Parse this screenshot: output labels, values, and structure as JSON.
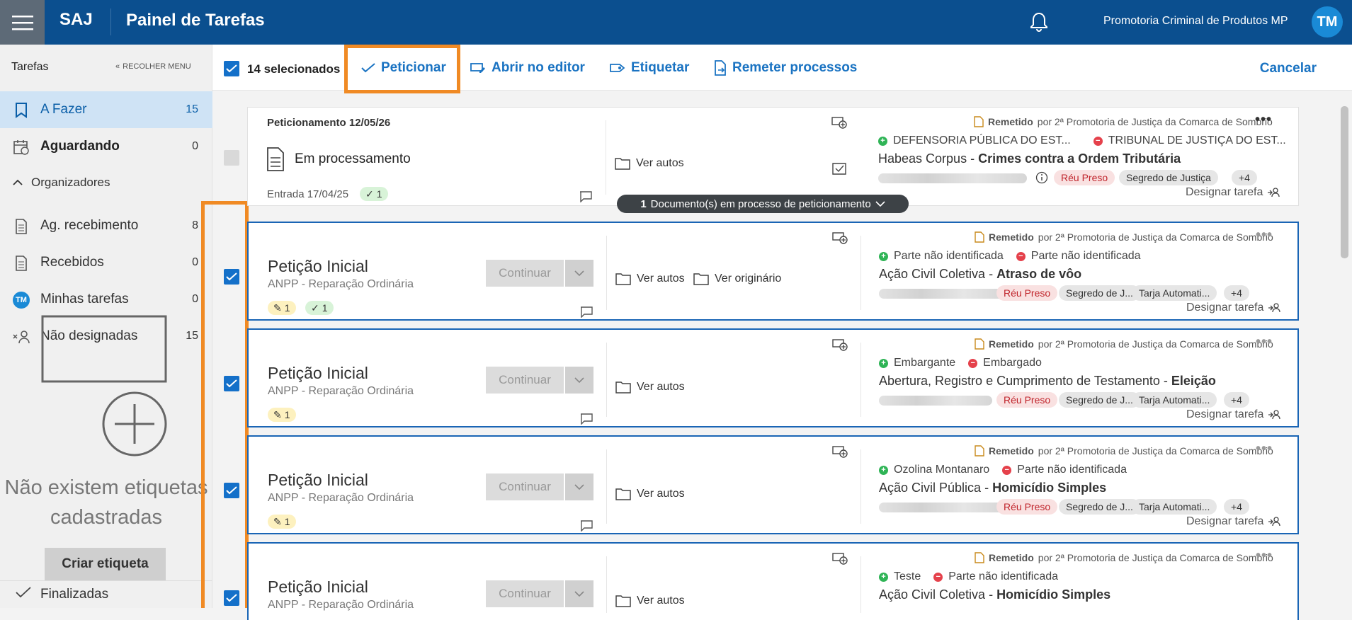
{
  "topbar": {
    "brand": "SAJ",
    "title": "Painel de Tarefas",
    "org": "Promotoria Criminal de Produtos MP",
    "avatar": "TM",
    "color": "#0b4f8f"
  },
  "sidebar": {
    "title": "Tarefas",
    "collapse": "RECOLHER MENU",
    "items": [
      {
        "label": "A Fazer",
        "count": "15",
        "icon": "bookmark-icon"
      },
      {
        "label": "Aguardando",
        "count": "0",
        "icon": "calendar-icon"
      },
      {
        "label": "Ag. recebimento",
        "count": "8",
        "icon": "document-icon"
      },
      {
        "label": "Recebidos",
        "count": "0",
        "icon": "document-icon"
      },
      {
        "label": "Minhas tarefas",
        "count": "0",
        "icon": "avatar-icon",
        "avatar": "TM"
      },
      {
        "label": "Não designadas",
        "count": "15",
        "icon": "unassigned-user-icon"
      }
    ],
    "organizers": "Organizadores",
    "empty_line1": "Não existem etiquetas",
    "empty_line2": "cadastradas",
    "create_label": "Criar etiqueta",
    "finalizadas": "Finalizadas"
  },
  "toolbar": {
    "selected": "14 selecionados",
    "peticionar": "Peticionar",
    "abrir_editor": "Abrir no editor",
    "etiquetar": "Etiquetar",
    "remeter": "Remeter processos",
    "cancelar": "Cancelar",
    "highlight_color": "#f08a24"
  },
  "notice": {
    "count": "1",
    "text": "Documento(s) em processo de peticionamento"
  },
  "cards": [
    {
      "header": "Peticionamento 12/05/26",
      "title": "Em processamento",
      "entrada": "Entrada 17/04/25",
      "check_count": "1",
      "ver_autos": "Ver autos",
      "remetido": "Remetido",
      "remetido_por": "por 2ª Promotoria de Justiça da Comarca de Sombrio",
      "party_plus": "DEFENSORIA PÚBLICA DO EST...",
      "party_minus": "TRIBUNAL DE JUSTIÇA DO EST...",
      "classe": "Habeas Corpus",
      "assunto": "Crimes contra a Ordem Tributária",
      "tags": [
        "Réu Preso",
        "Segredo de Justiça",
        "+4"
      ],
      "designar": "Designar tarefa"
    },
    {
      "title": "Petição Inicial",
      "subtitle": "ANPP - Reparação Ordinária",
      "edit_count": "1",
      "check_count": "1",
      "continuar": "Continuar",
      "ver_autos": "Ver autos",
      "ver_original": "Ver originário",
      "remetido": "Remetido",
      "remetido_por": "por 2ª Promotoria de Justiça da Comarca de Sombrio",
      "party_plus": "Parte não identificada",
      "party_minus": "Parte não identificada",
      "classe": "Ação Civil Coletiva",
      "assunto": "Atraso de vôo",
      "tags": [
        "Réu Preso",
        "Segredo de J...",
        "Tarja Automati...",
        "+4"
      ],
      "designar": "Designar tarefa"
    },
    {
      "title": "Petição Inicial",
      "subtitle": "ANPP - Reparação Ordinária",
      "edit_count": "1",
      "continuar": "Continuar",
      "ver_autos": "Ver autos",
      "remetido": "Remetido",
      "remetido_por": "por 2ª Promotoria de Justiça da Comarca de Sombrio",
      "party_plus": "Embargante",
      "party_minus": "Embargado",
      "classe": "Abertura, Registro e Cumprimento de Testamento",
      "assunto": "Eleição",
      "tags": [
        "Réu Preso",
        "Segredo de J...",
        "Tarja Automati...",
        "+4"
      ],
      "designar": "Designar tarefa"
    },
    {
      "title": "Petição Inicial",
      "subtitle": "ANPP - Reparação Ordinária",
      "edit_count": "1",
      "continuar": "Continuar",
      "ver_autos": "Ver autos",
      "remetido": "Remetido",
      "remetido_por": "por 2ª Promotoria de Justiça da Comarca de Sombrio",
      "party_plus": "Ozolina Montanaro",
      "party_minus": "Parte não identificada",
      "classe": "Ação Civil Pública",
      "assunto": "Homicídio Simples",
      "tags": [
        "Réu Preso",
        "Segredo de J...",
        "Tarja Automati...",
        "+4"
      ],
      "designar": "Designar tarefa"
    },
    {
      "title": "Petição Inicial",
      "subtitle": "ANPP - Reparação Ordinária",
      "continuar": "Continuar",
      "ver_autos": "Ver autos",
      "remetido": "Remetido",
      "remetido_por": "por 2ª Promotoria de Justiça da Comarca de Sombrio",
      "party_plus": "Teste",
      "party_minus": "Parte não identificada",
      "classe": "Ação Civil Coletiva",
      "assunto": "Homicídio Simples"
    }
  ]
}
